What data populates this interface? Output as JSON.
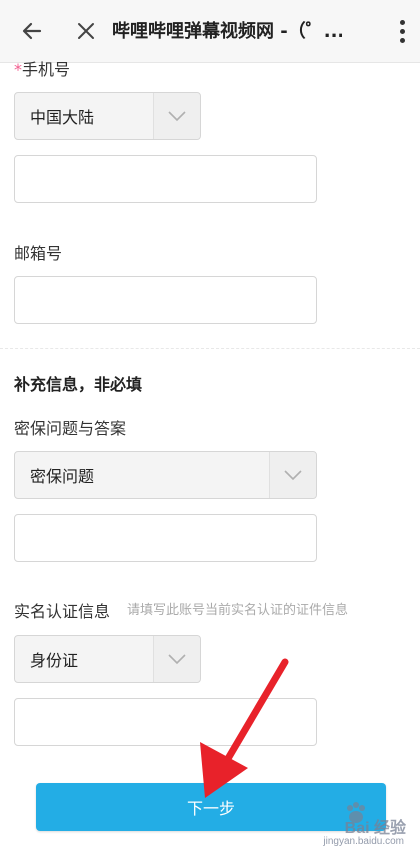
{
  "header": {
    "title": "哔哩哔哩弹幕视频网 -（゜",
    "back_icon": "arrow-left-icon",
    "close_icon": "close-icon",
    "more_icon": "more-vertical-icon",
    "ellipsis": "..."
  },
  "phone": {
    "label": "手机号",
    "required_mark": "*",
    "region_value": "中国大陆",
    "number_value": ""
  },
  "email": {
    "label": "邮箱号",
    "value": ""
  },
  "supplement": {
    "title": "补充信息，非必填"
  },
  "security": {
    "label": "密保问题与答案",
    "question_value": "密保问题",
    "answer_value": ""
  },
  "realname": {
    "label": "实名认证信息",
    "hint": "请填写此账号当前实名认证的证件信息",
    "id_type_value": "身份证",
    "id_number_value": ""
  },
  "next_button": {
    "label": "下一步"
  },
  "watermark": {
    "main": "Bai 经验",
    "sub": "jingyan.baidu.com"
  },
  "colors": {
    "accent": "#23ade5",
    "required": "#f25d8e",
    "annotation_arrow": "#e8222a"
  }
}
